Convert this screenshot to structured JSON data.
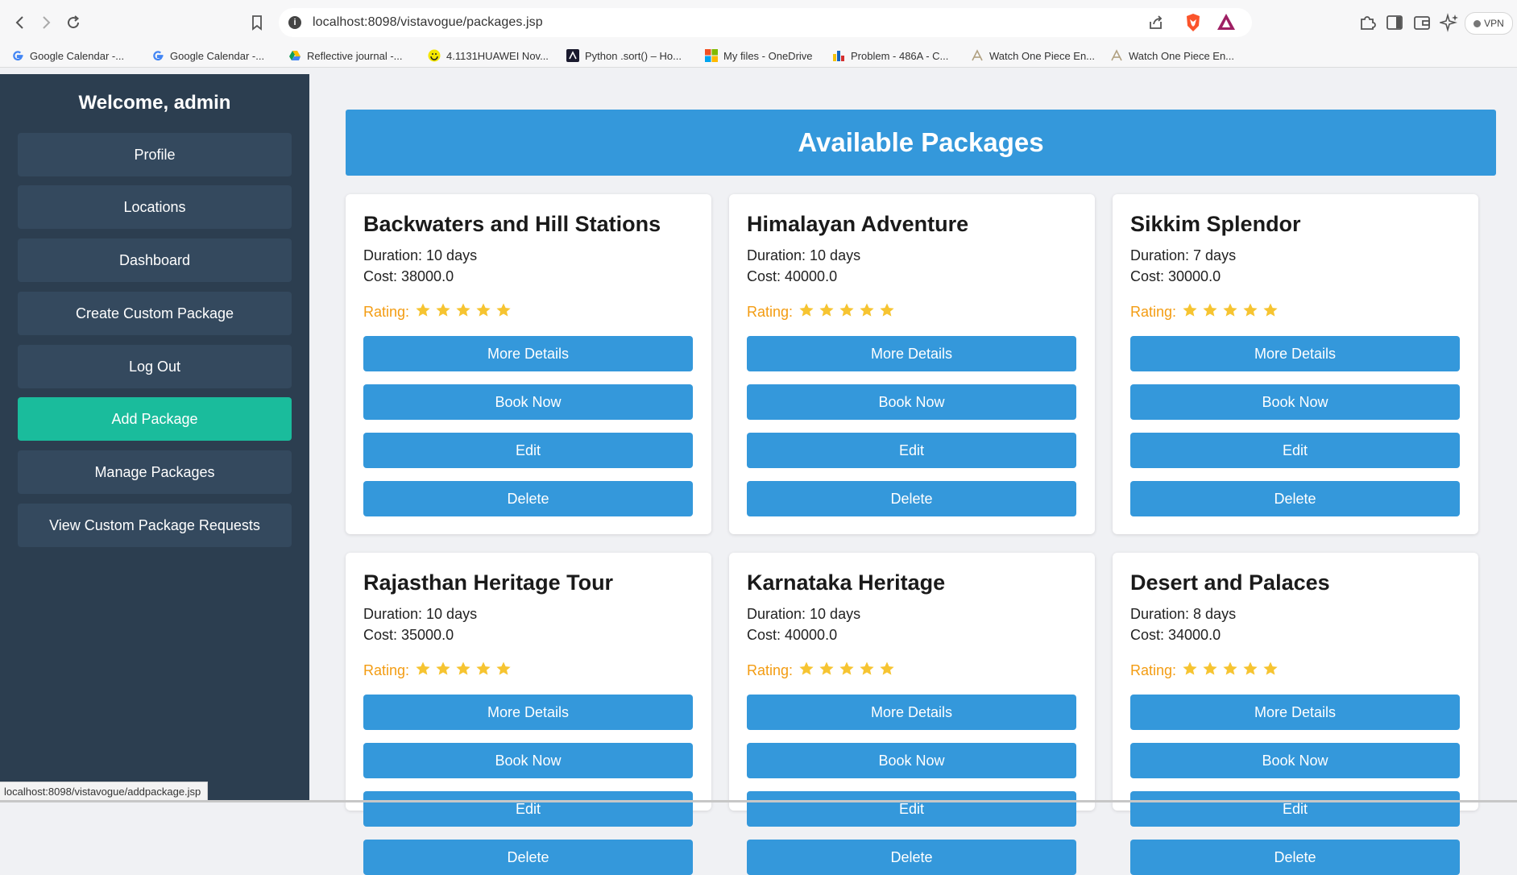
{
  "browser": {
    "url": "localhost:8098/vistavogue/packages.jsp",
    "vpn_label": "VPN",
    "bookmarks": [
      {
        "label": "Google Calendar -...",
        "icon": "google-icon"
      },
      {
        "label": "Google Calendar -...",
        "icon": "google-icon"
      },
      {
        "label": "Reflective journal -...",
        "icon": "drive-icon"
      },
      {
        "label": "4.1131HUAWEI Nov...",
        "icon": "smiley-icon"
      },
      {
        "label": "Python .sort() – Ho...",
        "icon": "code-icon"
      },
      {
        "label": "My files - OneDrive",
        "icon": "microsoft-icon"
      },
      {
        "label": "Problem - 486A - C...",
        "icon": "codeforces-icon"
      },
      {
        "label": "Watch One Piece En...",
        "icon": "anime-icon"
      },
      {
        "label": "Watch One Piece En...",
        "icon": "anime-icon"
      }
    ],
    "status_url": "localhost:8098/vistavogue/addpackage.jsp"
  },
  "sidebar": {
    "welcome": "Welcome, admin",
    "items": [
      {
        "label": "Profile",
        "active": false
      },
      {
        "label": "Locations",
        "active": false
      },
      {
        "label": "Dashboard",
        "active": false
      },
      {
        "label": "Create Custom Package",
        "active": false
      },
      {
        "label": "Log Out",
        "active": false
      },
      {
        "label": "Add Package",
        "active": true
      },
      {
        "label": "Manage Packages",
        "active": false
      },
      {
        "label": "View Custom Package Requests",
        "active": false
      }
    ]
  },
  "main": {
    "title": "Available Packages",
    "rating_label": "Rating:",
    "buttons": {
      "more": "More Details",
      "book": "Book Now",
      "edit": "Edit",
      "delete": "Delete"
    },
    "packages": [
      {
        "name": "Backwaters and Hill Stations",
        "duration": "Duration: 10 days",
        "cost": "Cost: 38000.0",
        "rating": 5
      },
      {
        "name": "Himalayan Adventure",
        "duration": "Duration: 10 days",
        "cost": "Cost: 40000.0",
        "rating": 5
      },
      {
        "name": "Sikkim Splendor",
        "duration": "Duration: 7 days",
        "cost": "Cost: 30000.0",
        "rating": 5
      },
      {
        "name": "Rajasthan Heritage Tour",
        "duration": "Duration: 10 days",
        "cost": "Cost: 35000.0",
        "rating": 5
      },
      {
        "name": "Karnataka Heritage",
        "duration": "Duration: 10 days",
        "cost": "Cost: 40000.0",
        "rating": 5
      },
      {
        "name": "Desert and Palaces",
        "duration": "Duration: 8 days",
        "cost": "Cost: 34000.0",
        "rating": 5
      }
    ]
  },
  "colors": {
    "sidebar_bg": "#2c3e50",
    "sidebar_item": "#34495e",
    "active_item": "#1abc9c",
    "primary": "#3498db",
    "rating": "#f39c12",
    "star": "#f6c431"
  }
}
